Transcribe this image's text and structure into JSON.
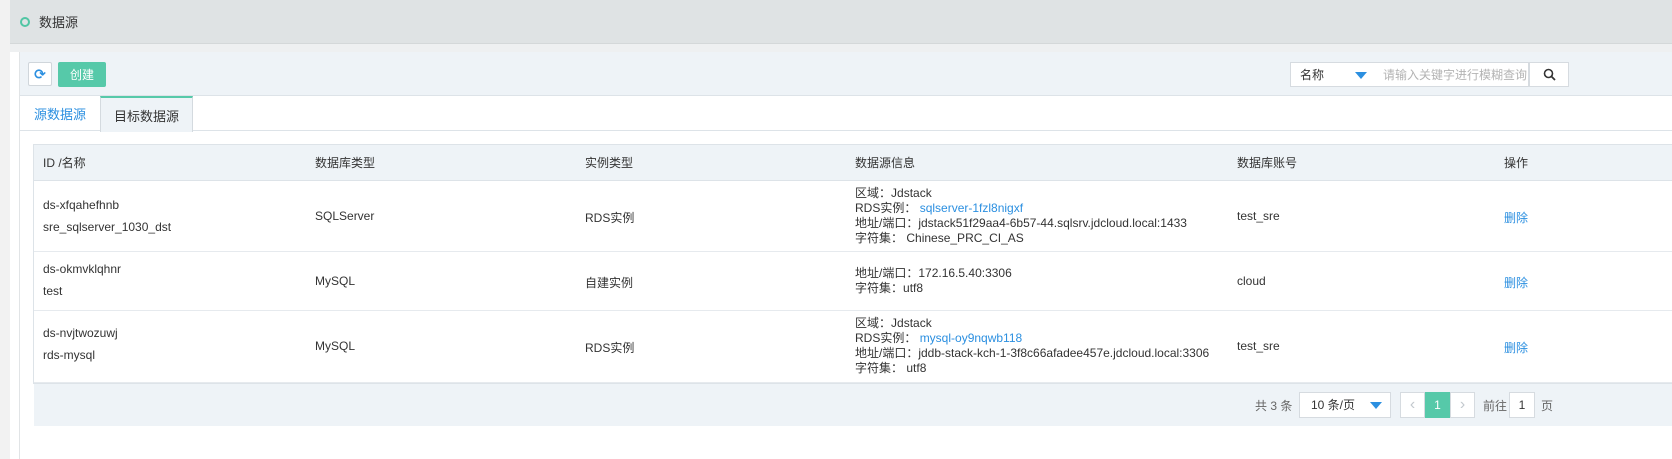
{
  "header": {
    "title": "数据源"
  },
  "toolbar": {
    "create_label": "创建",
    "search_field": "名称",
    "search_placeholder": "请输入关键字进行模糊查询"
  },
  "tabs": [
    {
      "label": "源数据源",
      "active": false
    },
    {
      "label": "目标数据源",
      "active": true
    }
  ],
  "table": {
    "columns": [
      "ID /名称",
      "数据库类型",
      "实例类型",
      "数据源信息",
      "数据库账号",
      "操作"
    ],
    "rows": [
      {
        "id": "ds-xfqahefhnb",
        "name": "sre_sqlserver_1030_dst",
        "db_type": "SQLServer",
        "instance_type": "RDS实例",
        "info": {
          "region_label": "区域：",
          "region": "Jdstack",
          "rds_label": "RDS实例：",
          "rds": "sqlserver-1fzl8nigxf",
          "addr_label": "地址/端口：",
          "addr": "jdstack51f29aa4-6b57-44.sqlsrv.jdcloud.local:1433",
          "charset_label": "字符集：",
          "charset": "Chinese_PRC_CI_AS"
        },
        "account": "test_sre",
        "action": "删除"
      },
      {
        "id": "ds-okmvklqhnr",
        "name": "test",
        "db_type": "MySQL",
        "instance_type": "自建实例",
        "info": {
          "addr_label": "地址/端口：",
          "addr": "172.16.5.40:3306",
          "charset_label": "字符集：",
          "charset": "utf8"
        },
        "account": "cloud",
        "action": "删除"
      },
      {
        "id": "ds-nvjtwozuwj",
        "name": "rds-mysql",
        "db_type": "MySQL",
        "instance_type": "RDS实例",
        "info": {
          "region_label": "区域：",
          "region": "Jdstack",
          "rds_label": "RDS实例：",
          "rds": "mysql-oy9nqwb118",
          "addr_label": "地址/端口：",
          "addr": "jddb-stack-kch-1-3f8c66afadee457e.jdcloud.local:3306",
          "charset_label": "字符集：",
          "charset": "utf8"
        },
        "account": "test_sre",
        "action": "删除"
      }
    ]
  },
  "pagination": {
    "total": "共 3 条",
    "page_size": "10 条/页",
    "current_page": "1",
    "goto_label": "前往",
    "goto_value": "1",
    "page_suffix": "页"
  },
  "icons": {
    "refresh": "refresh-icon",
    "search": "search-icon",
    "prev": "chevron-left-icon",
    "next": "chevron-right-icon"
  },
  "colors": {
    "accent": "#56c9a9",
    "link": "#2b8fe0"
  }
}
